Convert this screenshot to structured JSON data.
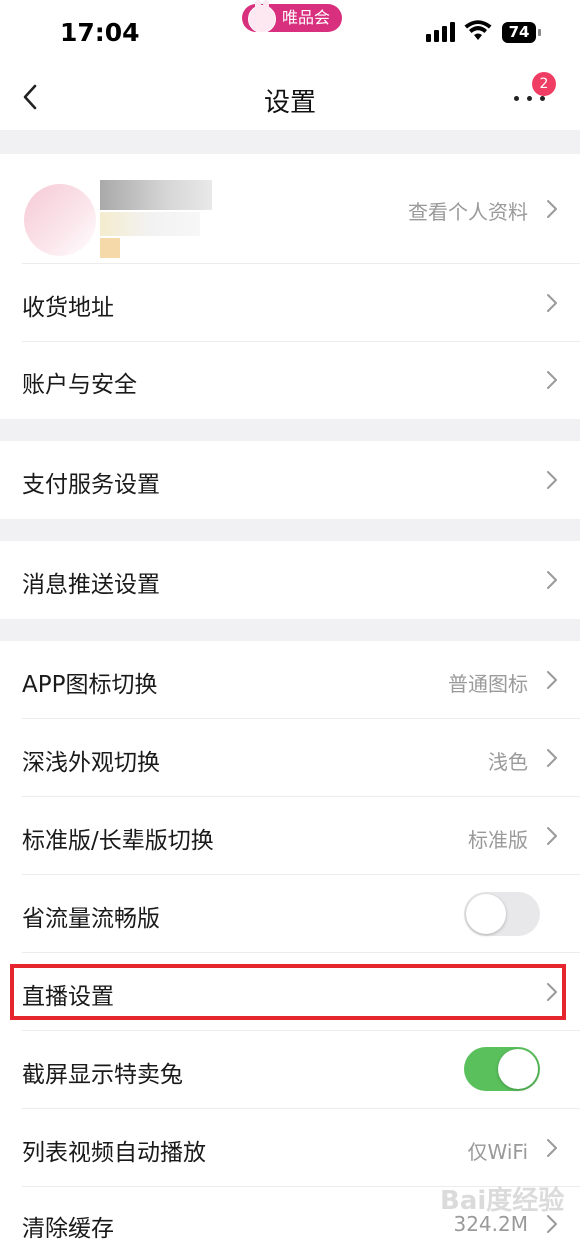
{
  "status_bar": {
    "time": "17:04",
    "app_name": "唯品会",
    "battery": "74",
    "icons": [
      "signal-icon",
      "wifi-icon",
      "battery-icon"
    ]
  },
  "nav": {
    "title": "设置",
    "back_icon": "back-arrow-icon",
    "more_icon": "more-dots-icon",
    "badge_count": "2"
  },
  "profile": {
    "view_profile_label": "查看个人资料"
  },
  "groups": {
    "account": {
      "address": "收货地址",
      "security": "账户与安全"
    },
    "payment": {
      "label": "支付服务设置"
    },
    "notification": {
      "label": "消息推送设置"
    },
    "general": {
      "app_icon": {
        "label": "APP图标切换",
        "value": "普通图标"
      },
      "appearance": {
        "label": "深浅外观切换",
        "value": "浅色"
      },
      "version": {
        "label": "标准版/长辈版切换",
        "value": "标准版"
      },
      "data_saver": {
        "label": "省流量流畅版",
        "enabled": false
      },
      "live": {
        "label": "直播设置"
      },
      "screenshot": {
        "label": "截屏显示特卖兔",
        "enabled": true
      },
      "autoplay": {
        "label": "列表视频自动播放",
        "value": "仅WiFi"
      },
      "cache": {
        "label": "清除缓存",
        "value": "324.2M"
      }
    }
  },
  "colors": {
    "highlight_border": "#e5262e",
    "toggle_on": "#5ac05c",
    "badge": "#f03d64",
    "app_pill": "#d8307f"
  },
  "watermark": "Bai度经验"
}
